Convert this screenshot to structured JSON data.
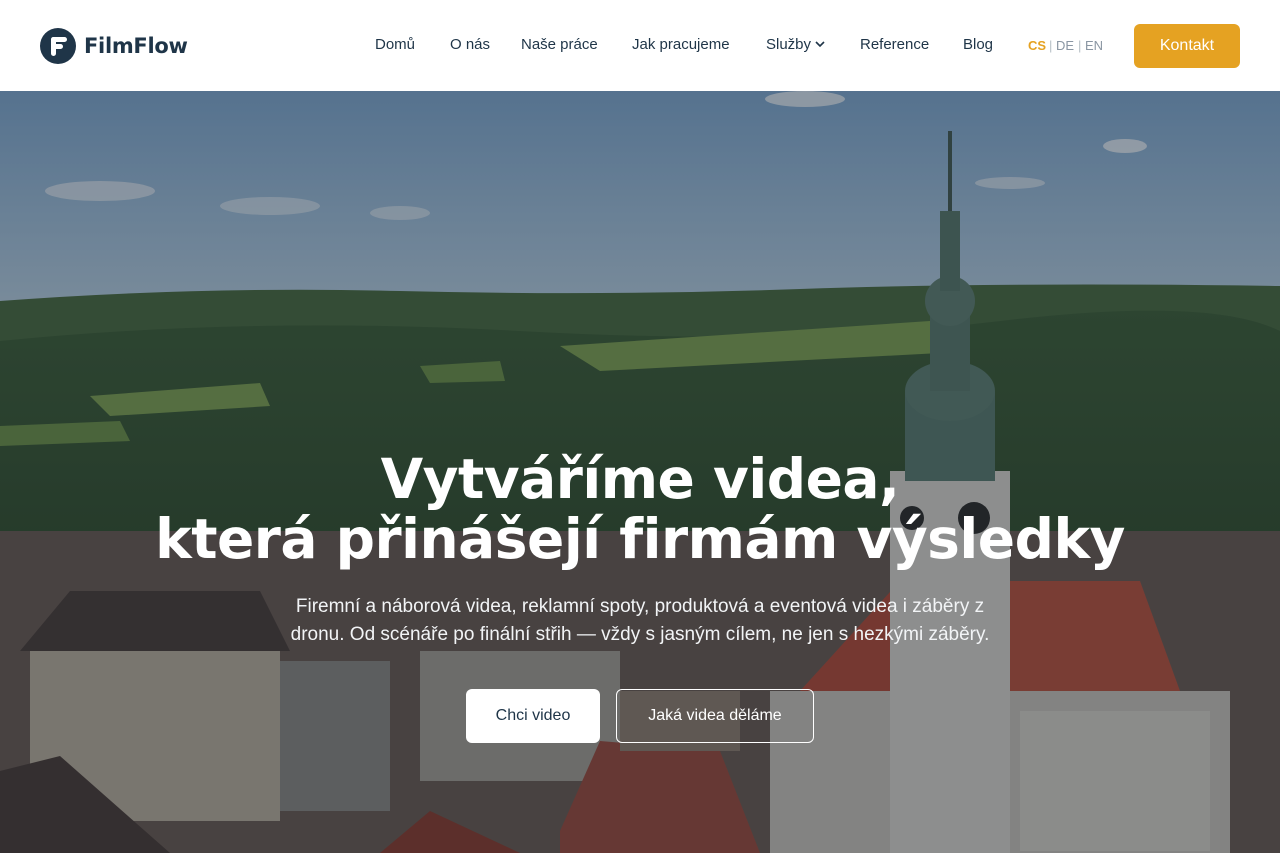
{
  "brand": {
    "name": "FilmFlow",
    "logo_icon": "film-f-logo-icon"
  },
  "nav": {
    "items": [
      {
        "label": "Domů"
      },
      {
        "label": "O nás"
      },
      {
        "label": "Naše práce"
      },
      {
        "label": "Jak pracujeme"
      },
      {
        "label": "Služby",
        "has_dropdown": true
      },
      {
        "label": "Reference"
      },
      {
        "label": "Blog"
      }
    ],
    "dropdown_icon": "chevron-down-icon"
  },
  "languages": {
    "options": [
      "CS",
      "DE",
      "EN"
    ],
    "active": "CS",
    "separator": "|"
  },
  "contact_button": {
    "label": "Kontakt"
  },
  "hero": {
    "headline_line1": "Vytváříme videa,",
    "headline_line2": "která přinášejí firmám výsledky",
    "subtext_line1": "Firemní a náborová videa, reklamní spoty, produktová a eventová videa i záběry z",
    "subtext_line2": "dronu. Od scénáře po finální střih — vždy s jasným cílem, ne jen s hezkými záběry.",
    "primary_button": "Chci video",
    "secondary_button": "Jaká videa děláme",
    "background": "aerial-town-photo"
  },
  "colors": {
    "brand_navy": "#1f3548",
    "accent_orange": "#e5a222",
    "header_bg": "#ffffff",
    "inactive_lang": "#8a96a3"
  }
}
